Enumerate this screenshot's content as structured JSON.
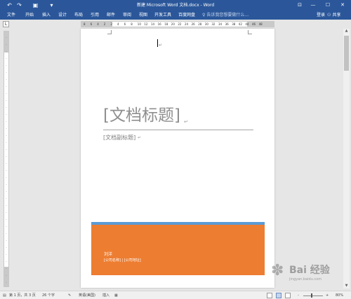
{
  "window": {
    "title": "新建 Microsoft Word 文档.docx - Word",
    "qa_undo": "↶",
    "qa_redo": "↷",
    "qa_save": "▣",
    "qa_customize": "▾",
    "ribbon_options": "⊡",
    "minimize": "—",
    "maximize": "☐",
    "close": "✕"
  },
  "ribbon": {
    "tabs": [
      "文件",
      "开始",
      "插入",
      "设计",
      "布局",
      "引用",
      "邮件",
      "审阅",
      "视图",
      "开发工具",
      "百度网盘"
    ],
    "tell_me": "告诉我您想要做什么...",
    "login": "登录",
    "share": "共享"
  },
  "ruler": {
    "tab_selector": "L",
    "ticks": [
      "8",
      "6",
      "4",
      "2",
      "2",
      "4",
      "6",
      "8",
      "10",
      "12",
      "14",
      "16",
      "18",
      "20",
      "22",
      "24",
      "26",
      "28",
      "30",
      "32",
      "34",
      "36",
      "38",
      "42",
      "44",
      "46",
      "48"
    ]
  },
  "document": {
    "title_placeholder": "[文档标题]",
    "subtitle_placeholder": "[文档副标题]",
    "author": "刘洋",
    "company_line": "[公司名称] | [公司地址]",
    "paragraph_mark": "↵"
  },
  "status": {
    "page": "第 1 页，共 3 页",
    "words": "26 个字",
    "language": "英语(美国)",
    "mode": "插入",
    "zoom_minus": "-",
    "zoom_plus": "+",
    "zoom": "80%",
    "zoom_level_percent": 80
  },
  "watermark": {
    "brand": "Bai 经验",
    "url": "jingyan.baidu.com"
  },
  "colors": {
    "accent": "#2b579a",
    "cover_orange": "#ed7d31",
    "cover_blue": "#5b9bd5"
  }
}
